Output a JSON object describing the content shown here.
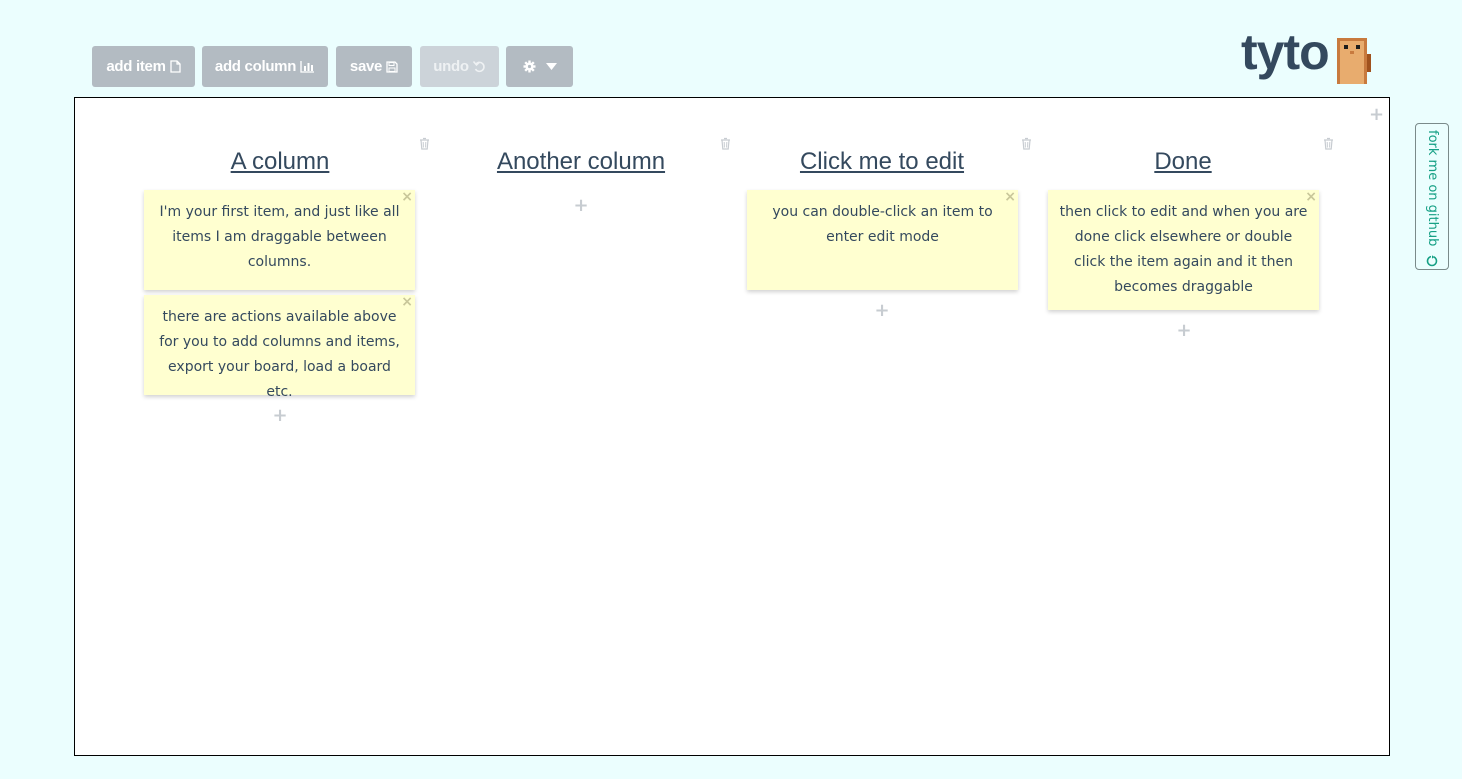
{
  "toolbar": {
    "add_item": {
      "label": "add item",
      "icon": "file-icon"
    },
    "add_column": {
      "label": "add column",
      "icon": "bar-chart-icon"
    },
    "save": {
      "label": "save",
      "icon": "floppy-icon"
    },
    "undo": {
      "label": "undo",
      "icon": "undo-icon",
      "disabled": true
    },
    "settings": {
      "icon": "gear-icon",
      "caret": "caret-down-icon"
    }
  },
  "logo": {
    "text": "tyto",
    "mascot": "owl-icon"
  },
  "fork": {
    "label": "fork me on github",
    "icon": "github-icon"
  },
  "columns": [
    {
      "title": "A column",
      "items": [
        "I'm your first item, and just like all items I am draggable between columns.",
        "there are actions available above for you to add columns and items, export your board, load a board etc."
      ]
    },
    {
      "title": "Another column",
      "items": []
    },
    {
      "title": "Click me to edit",
      "items": [
        "you can double-click an item to enter edit mode"
      ]
    },
    {
      "title": "Done",
      "items": [
        "then click to edit and when you are done click elsewhere or double click the item again and it then becomes draggable"
      ]
    }
  ],
  "glyphs": {
    "add": "+",
    "close": "×"
  },
  "colors": {
    "page_bg": "#ebfefe",
    "button_bg": "#b3bbc2",
    "item_bg": "#ffffd0",
    "title": "#34495e",
    "fork_text": "#16a085"
  }
}
